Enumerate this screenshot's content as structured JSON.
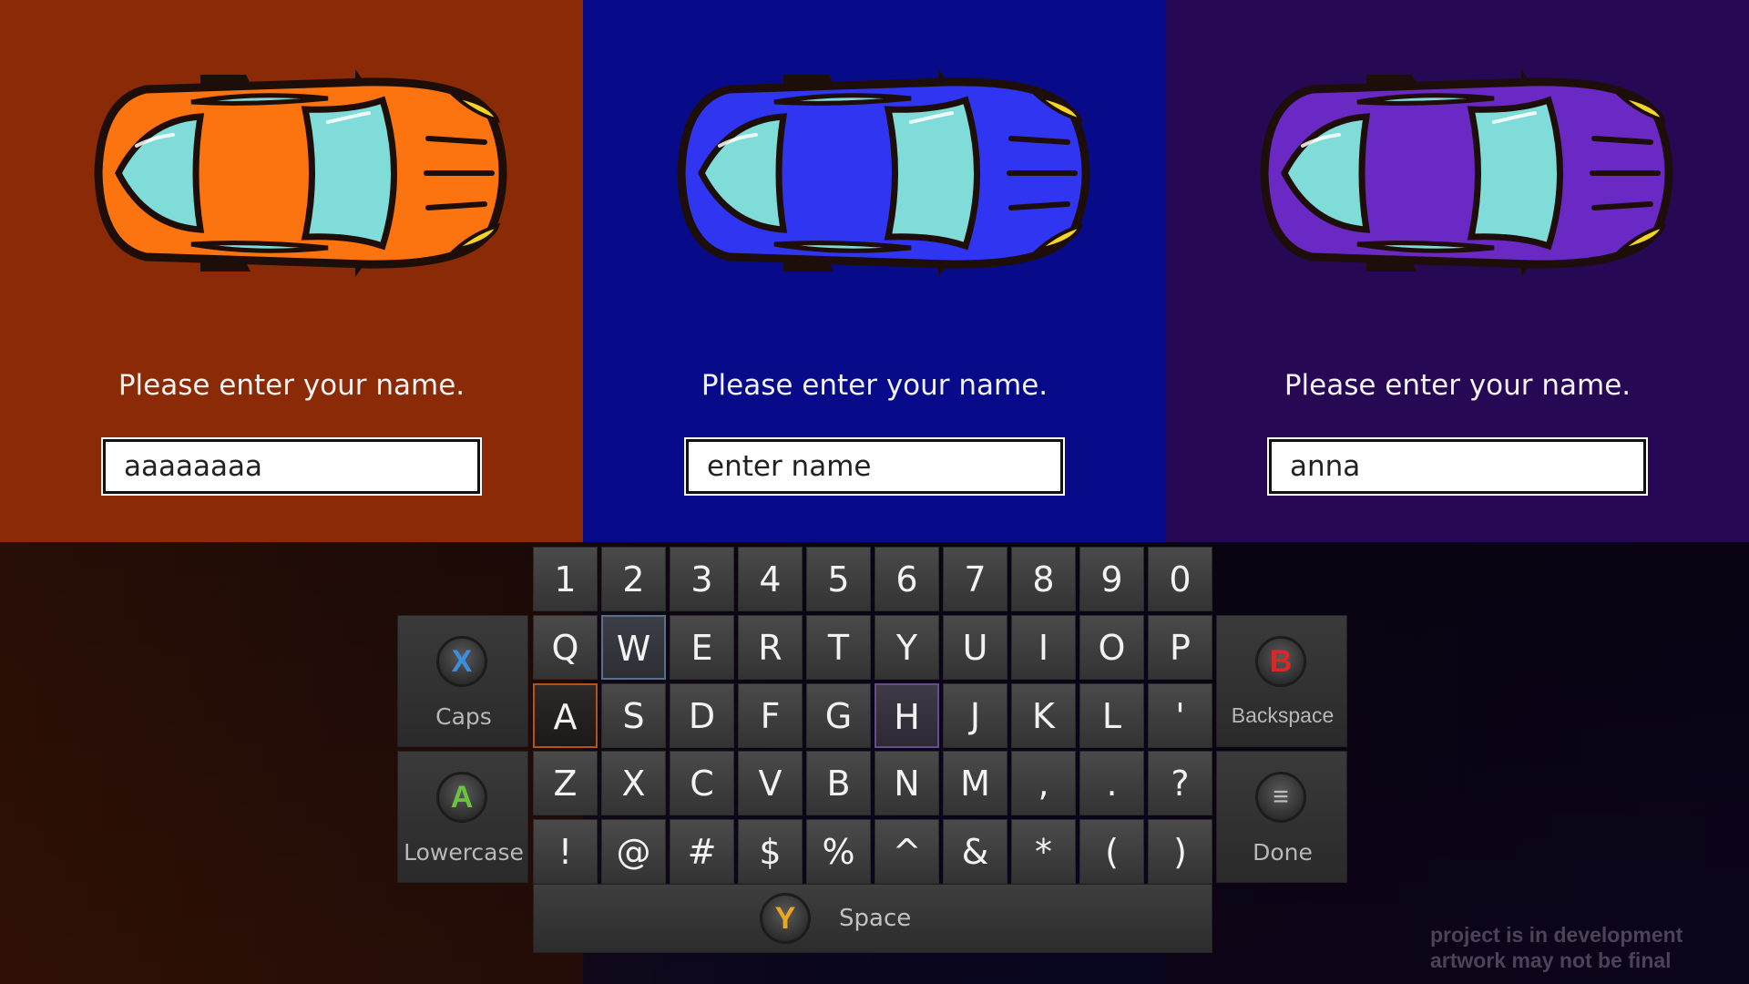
{
  "players": [
    {
      "car_color": "orange",
      "prompt": "Please enter your name.",
      "name_value": "aaaaaaaa"
    },
    {
      "car_color": "blue",
      "prompt": "Please enter your name.",
      "name_value": "enter name"
    },
    {
      "car_color": "purple",
      "prompt": "Please enter your name.",
      "name_value": "anna"
    }
  ],
  "keyboard": {
    "row_numbers": [
      "1",
      "2",
      "3",
      "4",
      "5",
      "6",
      "7",
      "8",
      "9",
      "0"
    ],
    "row_q": [
      "Q",
      "W",
      "E",
      "R",
      "T",
      "Y",
      "U",
      "I",
      "O",
      "P"
    ],
    "row_a": [
      "A",
      "S",
      "D",
      "F",
      "G",
      "H",
      "J",
      "K",
      "L",
      "'"
    ],
    "row_z": [
      "Z",
      "X",
      "C",
      "V",
      "B",
      "N",
      "M",
      ",",
      ".",
      "?"
    ],
    "row_symbols": [
      "!",
      "@",
      "#",
      "$",
      "%",
      "^",
      "&",
      "*",
      "(",
      ")"
    ],
    "selected_keys": [
      {
        "player": "orange",
        "key": "A"
      },
      {
        "player": "blue",
        "key": "W"
      },
      {
        "player": "purple",
        "key": "H"
      }
    ],
    "caps": {
      "glyph": "X",
      "label": "Caps"
    },
    "lowercase": {
      "glyph": "A",
      "label": "Lowercase"
    },
    "backspace": {
      "glyph": "B",
      "label": "Backspace"
    },
    "done": {
      "glyph": "≡",
      "label": "Done"
    },
    "space": {
      "glyph": "Y",
      "label": "Space"
    }
  },
  "watermark": {
    "line1": "project is in development",
    "line2": "artwork may not be final"
  },
  "colors": {
    "panel_orange": "#8a2a06",
    "panel_blue": "#070b8a",
    "panel_purple": "#260854",
    "car_orange": "#fb7410",
    "car_blue": "#2f35f0",
    "car_purple": "#6a28c4",
    "glass": "#7fdcd8",
    "headlight": "#f2d42a",
    "btn_x": "#3b8fe0",
    "btn_a": "#6cc43c",
    "btn_b": "#d42a2a",
    "btn_y": "#e8a820"
  }
}
